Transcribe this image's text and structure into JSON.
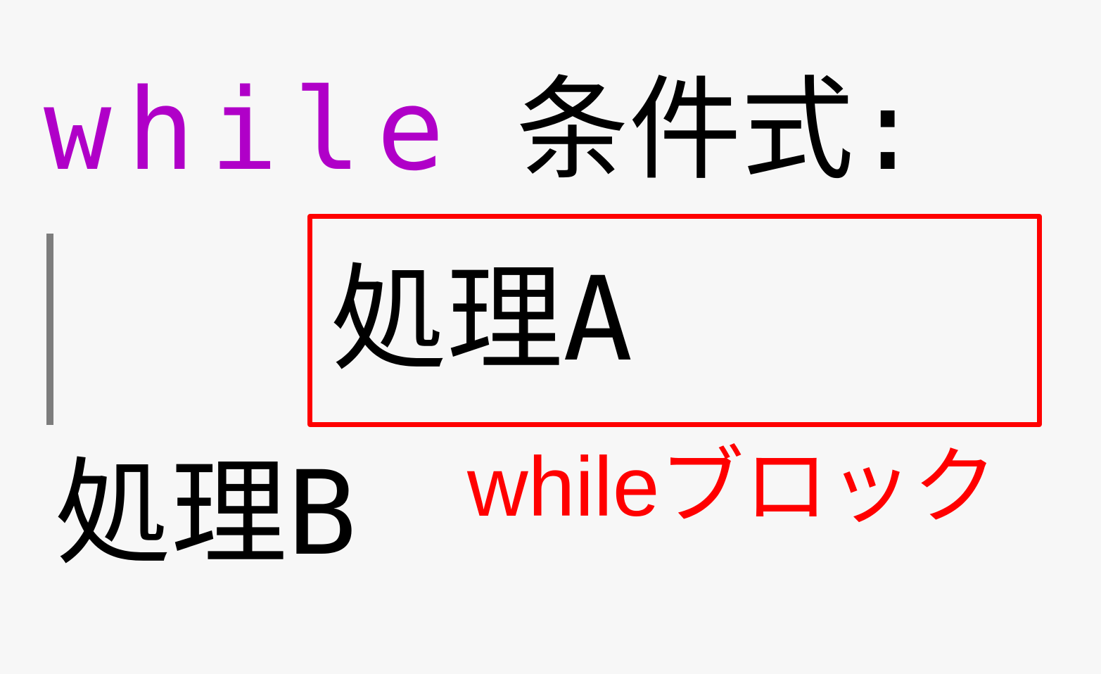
{
  "code": {
    "keyword": "while",
    "condition": "条件式:",
    "loop_body": "処理A",
    "after_loop": "処理B"
  },
  "annotation": {
    "label": "whileブロック"
  },
  "colors": {
    "background": "#f7f7f7",
    "keyword": "#b000c8",
    "text": "#000000",
    "indent_guide": "#7d7d7d",
    "highlight": "#ff0000"
  }
}
